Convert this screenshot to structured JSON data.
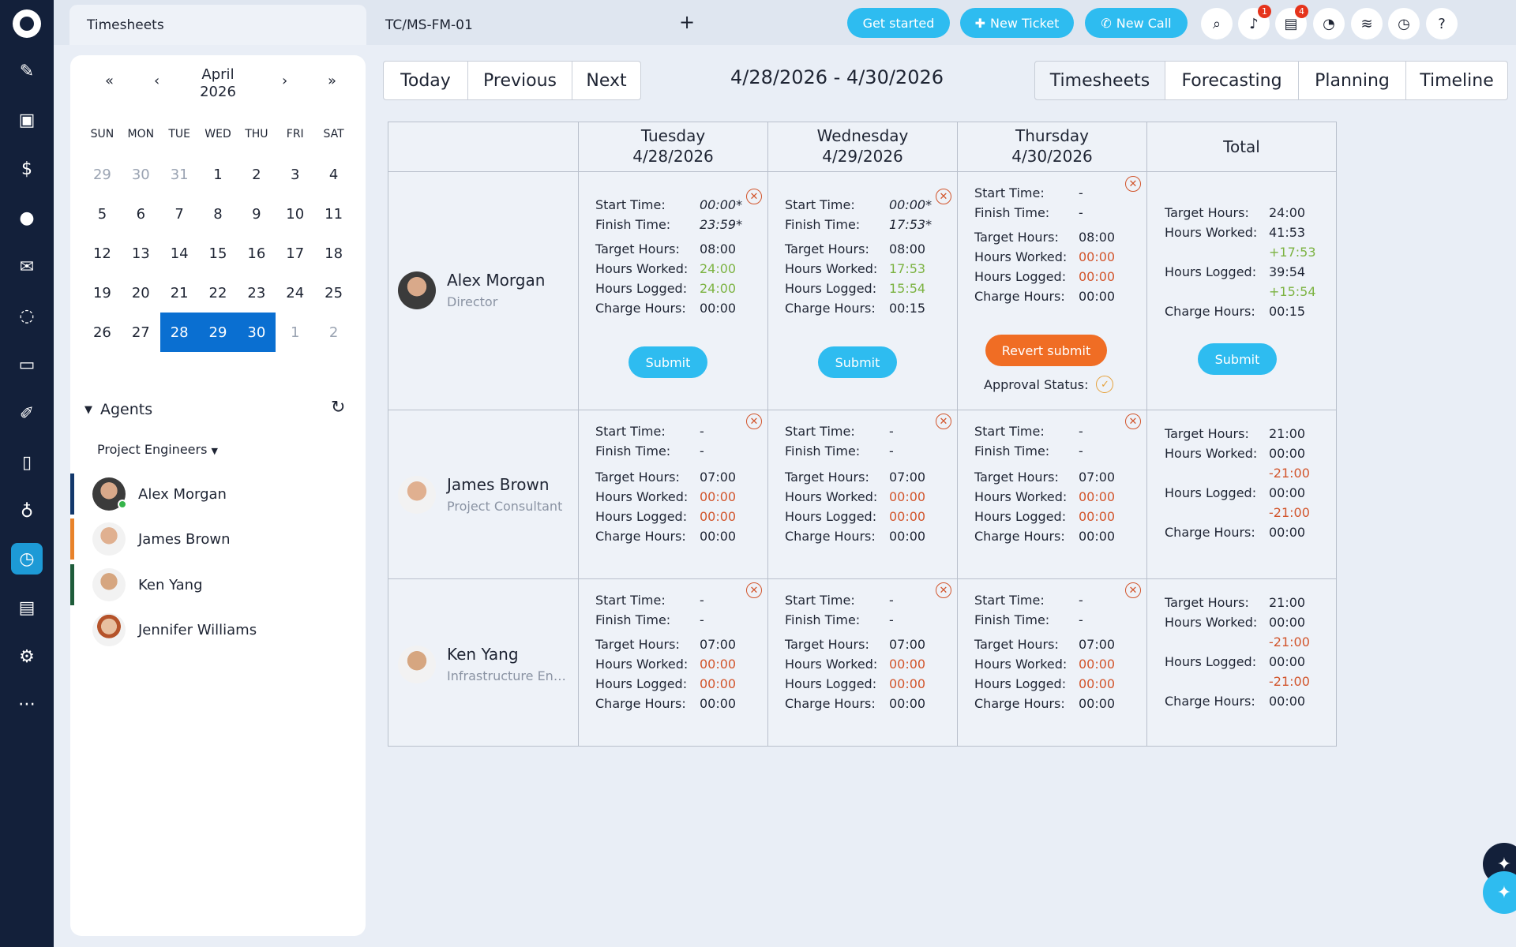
{
  "tabs": {
    "active": "Timesheets",
    "second": "TC/MS-FM-01",
    "add": "+"
  },
  "top_buttons": {
    "get_started": "Get started",
    "new_ticket": "New Ticket",
    "new_call": "New Call"
  },
  "badges": {
    "notifications": "1",
    "tasks": "4"
  },
  "calendar": {
    "month": "April",
    "year": "2026",
    "nav": {
      "prev_year": "«",
      "prev_month": "‹",
      "next_month": "›",
      "next_year": "»"
    },
    "days": [
      "SUN",
      "MON",
      "TUE",
      "WED",
      "THU",
      "FRI",
      "SAT"
    ],
    "weeks": [
      [
        "29",
        "30",
        "31",
        "1",
        "2",
        "3",
        "4"
      ],
      [
        "5",
        "6",
        "7",
        "8",
        "9",
        "10",
        "11"
      ],
      [
        "12",
        "13",
        "14",
        "15",
        "16",
        "17",
        "18"
      ],
      [
        "19",
        "20",
        "21",
        "22",
        "23",
        "24",
        "25"
      ],
      [
        "26",
        "27",
        "28",
        "29",
        "30",
        "1",
        "2"
      ]
    ]
  },
  "agents": {
    "title": "Agents",
    "group": "Project Engineers",
    "list": [
      {
        "name": "Alex Morgan",
        "bar": "#13386b"
      },
      {
        "name": "James Brown",
        "bar": "#e8822a"
      },
      {
        "name": "Ken Yang",
        "bar": "#1e5c3a"
      },
      {
        "name": "Jennifer Williams",
        "bar": ""
      }
    ]
  },
  "nav": {
    "today": "Today",
    "previous": "Previous",
    "next": "Next",
    "range": "4/28/2026 - 4/30/2026"
  },
  "views": {
    "timesheets": "Timesheets",
    "forecasting": "Forecasting",
    "planning": "Planning",
    "timeline": "Timeline"
  },
  "columns": [
    {
      "day": "Tuesday",
      "date": "4/28/2026"
    },
    {
      "day": "Wednesday",
      "date": "4/29/2026"
    },
    {
      "day": "Thursday",
      "date": "4/30/2026"
    },
    {
      "day": "Total",
      "date": ""
    }
  ],
  "labels": {
    "start": "Start Time:",
    "finish": "Finish Time:",
    "target": "Target Hours:",
    "worked": "Hours Worked:",
    "logged": "Hours Logged:",
    "charge": "Charge Hours:",
    "submit": "Submit",
    "revert": "Revert submit",
    "approval": "Approval Status:"
  },
  "rows": [
    {
      "name": "Alex Morgan",
      "role": "Director",
      "days": [
        {
          "start": "00:00*",
          "finish": "23:59*",
          "target": "08:00",
          "worked": "24:00",
          "logged": "24:00",
          "charge": "00:00"
        },
        {
          "start": "00:00*",
          "finish": "17:53*",
          "target": "08:00",
          "worked": "17:53",
          "logged": "15:54",
          "charge": "00:15"
        },
        {
          "start": "-",
          "finish": "-",
          "target": "08:00",
          "worked": "00:00",
          "logged": "00:00",
          "charge": "00:00"
        }
      ],
      "total": {
        "target": "24:00",
        "worked": "41:53",
        "worked_diff": "+17:53",
        "logged": "39:54",
        "logged_diff": "+15:54",
        "charge": "00:15"
      }
    },
    {
      "name": "James Brown",
      "role": "Project Consultant",
      "days": [
        {
          "start": "-",
          "finish": "-",
          "target": "07:00",
          "worked": "00:00",
          "logged": "00:00",
          "charge": "00:00"
        },
        {
          "start": "-",
          "finish": "-",
          "target": "07:00",
          "worked": "00:00",
          "logged": "00:00",
          "charge": "00:00"
        },
        {
          "start": "-",
          "finish": "-",
          "target": "07:00",
          "worked": "00:00",
          "logged": "00:00",
          "charge": "00:00"
        }
      ],
      "total": {
        "target": "21:00",
        "worked": "00:00",
        "worked_diff": "-21:00",
        "logged": "00:00",
        "logged_diff": "-21:00",
        "charge": "00:00"
      }
    },
    {
      "name": "Ken Yang",
      "role": "Infrastructure Eng...",
      "days": [
        {
          "start": "-",
          "finish": "-",
          "target": "07:00",
          "worked": "00:00",
          "logged": "00:00",
          "charge": "00:00"
        },
        {
          "start": "-",
          "finish": "-",
          "target": "07:00",
          "worked": "00:00",
          "logged": "00:00",
          "charge": "00:00"
        },
        {
          "start": "-",
          "finish": "-",
          "target": "07:00",
          "worked": "00:00",
          "logged": "00:00",
          "charge": "00:00"
        }
      ],
      "total": {
        "target": "21:00",
        "worked": "00:00",
        "worked_diff": "-21:00",
        "logged": "00:00",
        "logged_diff": "-21:00",
        "charge": "00:00"
      }
    }
  ]
}
